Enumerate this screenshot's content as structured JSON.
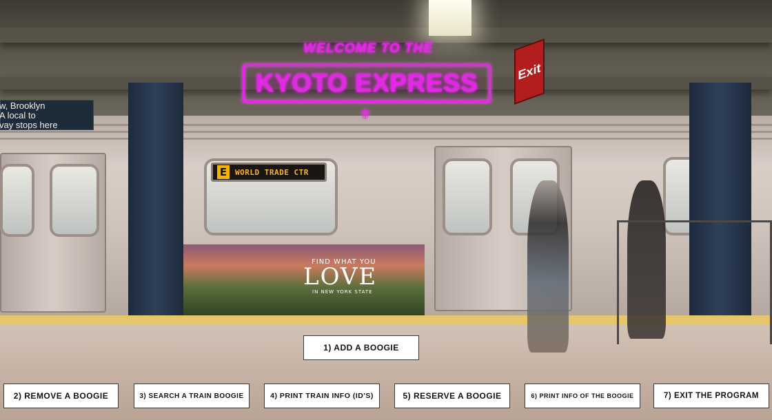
{
  "header": {
    "welcome": "WELCOME TO THE",
    "title": "KYOTO EXPRESS",
    "ornament": "⚜"
  },
  "scene": {
    "station_sign_lines": [
      "w, Brooklyn",
      "A  local to",
      "vay stops here"
    ],
    "exit_sign": "Exit",
    "train_destination_letter": "E",
    "train_destination": "WORLD TRADE CTR",
    "ad_subtitle": "FIND WHAT YOU",
    "ad_headline": "LOVE",
    "ad_footer": "IN NEW YORK STATE"
  },
  "menu": {
    "add_boogie": "1) ADD A BOOGIE",
    "remove_boogie": "2) REMOVE A BOOGIE",
    "search_boogie": "3) SEARCH A TRAIN BOOGIE",
    "print_train_info": "4) PRINT TRAIN INFO (ID'S)",
    "reserve_boogie": "5) RESERVE A BOOGIE",
    "print_boogie_info": "6) PRINT INFO OF THE BOOGIE",
    "exit_program": "7) EXIT THE PROGRAM"
  },
  "colors": {
    "neon": "#e426e6",
    "button_bg": "#ffffff",
    "button_text": "#111111"
  }
}
